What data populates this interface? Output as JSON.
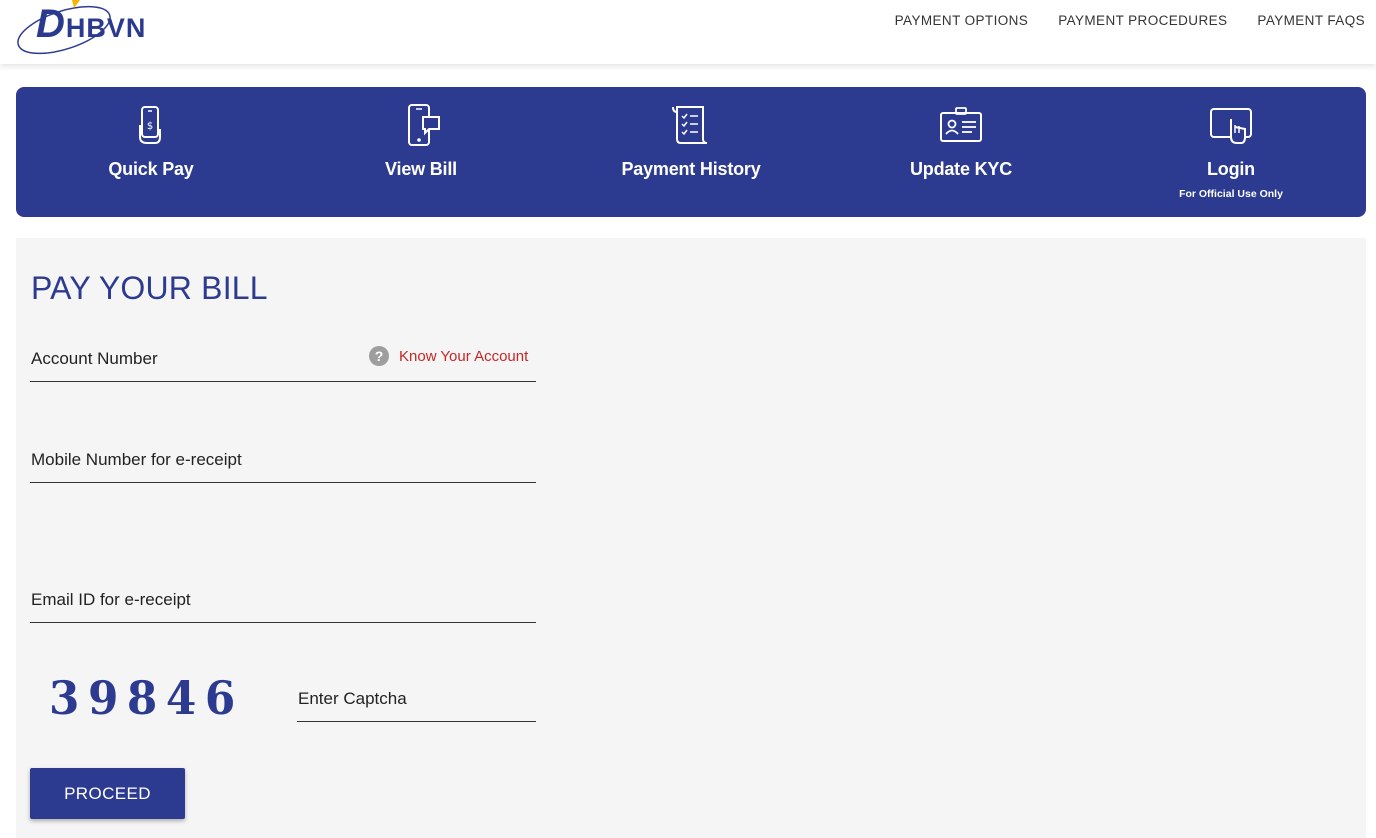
{
  "brand": {
    "logo_text_first": "D",
    "logo_text_rest": "HBVN",
    "color": "#2c3b90"
  },
  "topnav": [
    {
      "label": "PAYMENT OPTIONS"
    },
    {
      "label": "PAYMENT PROCEDURES"
    },
    {
      "label": "PAYMENT FAQS"
    }
  ],
  "actions": [
    {
      "label": "Quick Pay",
      "icon": "mobile-pay-icon"
    },
    {
      "label": "View Bill",
      "icon": "mobile-bill-icon"
    },
    {
      "label": "Payment History",
      "icon": "receipt-scroll-icon"
    },
    {
      "label": "Update KYC",
      "icon": "id-card-icon"
    },
    {
      "label": "Login",
      "sublabel": "For Official Use Only",
      "icon": "touch-screen-icon"
    }
  ],
  "form": {
    "title": "PAY YOUR BILL",
    "account_placeholder": "Account Number",
    "know_account_label": "Know Your Account",
    "help_glyph": "?",
    "mobile_placeholder": "Mobile Number for e-receipt",
    "email_placeholder": "Email ID for e-receipt",
    "captcha_value": "39846",
    "captcha_placeholder": "Enter Captcha",
    "proceed_label": "PROCEED"
  }
}
